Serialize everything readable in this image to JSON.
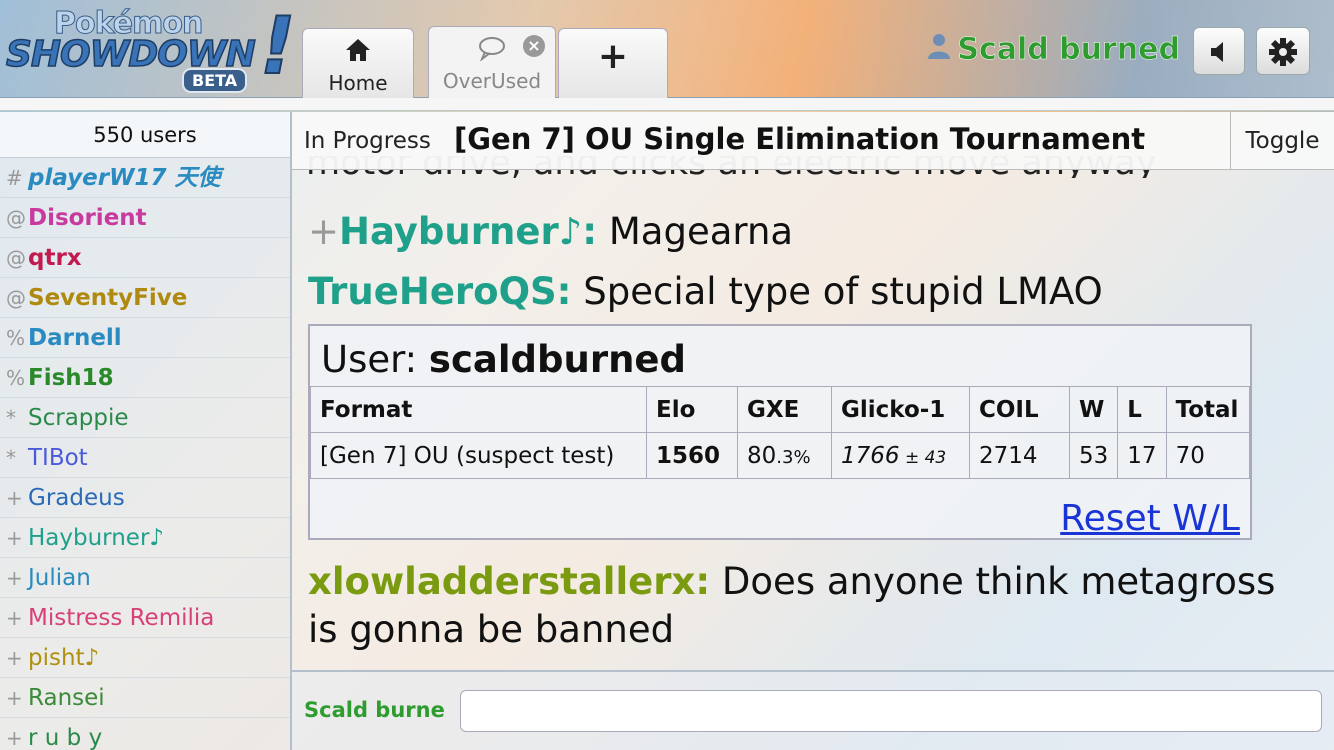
{
  "header": {
    "logo": {
      "pokemon": "Pokémon",
      "showdown": "SHOWDOWN",
      "bang": "!",
      "beta": "BETA"
    },
    "tabs": [
      {
        "label": "Home",
        "icon": "home-icon"
      },
      {
        "label": "OverUsed",
        "icon": "chat-bubble-icon"
      },
      {
        "label": "",
        "icon": "plus-icon"
      }
    ],
    "username": "Scald burned",
    "icons": {
      "user": "user-icon",
      "sound": "speaker-icon",
      "settings": "gear-icon"
    }
  },
  "sidebar": {
    "user_count": "550 users",
    "users": [
      {
        "rank": "#",
        "name": "playerW17 天使",
        "color": "#2a8bc1",
        "bold": true,
        "italic": true
      },
      {
        "rank": "@",
        "name": "Disorient",
        "color": "#c83a9e",
        "bold": true,
        "italic": false
      },
      {
        "rank": "@",
        "name": "qtrx",
        "color": "#c01a4e",
        "bold": true,
        "italic": false
      },
      {
        "rank": "@",
        "name": "SeventyFive",
        "color": "#b08a10",
        "bold": true,
        "italic": false
      },
      {
        "rank": "%",
        "name": "Darnell",
        "color": "#2a8bc1",
        "bold": true,
        "italic": false
      },
      {
        "rank": "%",
        "name": "Fish18",
        "color": "#2a8a2a",
        "bold": true,
        "italic": false
      },
      {
        "rank": "*",
        "name": "Scrappie",
        "color": "#2a8a4a",
        "bold": false,
        "italic": false
      },
      {
        "rank": "*",
        "name": "TIBot",
        "color": "#4a5ad8",
        "bold": false,
        "italic": false
      },
      {
        "rank": "+",
        "name": "Gradeus",
        "color": "#2a6ab8",
        "bold": false,
        "italic": false
      },
      {
        "rank": "+",
        "name": "Hayburner♪",
        "color": "#1fa08a",
        "bold": false,
        "italic": false
      },
      {
        "rank": "+",
        "name": "Julian",
        "color": "#2a8bc1",
        "bold": false,
        "italic": false
      },
      {
        "rank": "+",
        "name": "Mistress Remilia",
        "color": "#d8407a",
        "bold": false,
        "italic": false
      },
      {
        "rank": "+",
        "name": "pisht♪",
        "color": "#b09010",
        "bold": false,
        "italic": false
      },
      {
        "rank": "+",
        "name": "Ransei",
        "color": "#3a8a3a",
        "bold": false,
        "italic": false
      },
      {
        "rank": "+",
        "name": "r u b y",
        "color": "#2a8a4a",
        "bold": false,
        "italic": false
      }
    ]
  },
  "room": {
    "status": "In Progress",
    "tournament_title": "[Gen 7] OU Single Elimination Tournament",
    "toggle": "Toggle"
  },
  "chat": {
    "cut_line": "motor drive, and clicks an electric move anyway",
    "messages": [
      {
        "group": "+",
        "author": "Hayburner♪:",
        "color": "#1fa08a",
        "text": " Magearna"
      },
      {
        "group": "",
        "author": "TrueHeroQS:",
        "color": "#1fa08a",
        "text": " Special type of stupid LMAO"
      },
      {
        "group": "",
        "author": "xlowladderstallerx:",
        "color": "#7a9a10",
        "text": " Does anyone think metagross",
        "text2": "is gonna be banned"
      }
    ]
  },
  "ranking": {
    "user_label": "User: ",
    "user_name": "scaldburned",
    "headers": [
      "Format",
      "Elo",
      "GXE",
      "Glicko-1",
      "COIL",
      "W",
      "L",
      "Total"
    ],
    "row": {
      "format": "[Gen 7] OU (suspect test)",
      "elo": "1560",
      "gxe_main": "80",
      "gxe_small": ".3%",
      "glicko": "1766",
      "glicko_dev": " ± 43",
      "coil": "2714",
      "w": "53",
      "l": "17",
      "total": "70"
    },
    "reset": "Reset W/L"
  },
  "input": {
    "label": "Scald burne",
    "value": ""
  }
}
